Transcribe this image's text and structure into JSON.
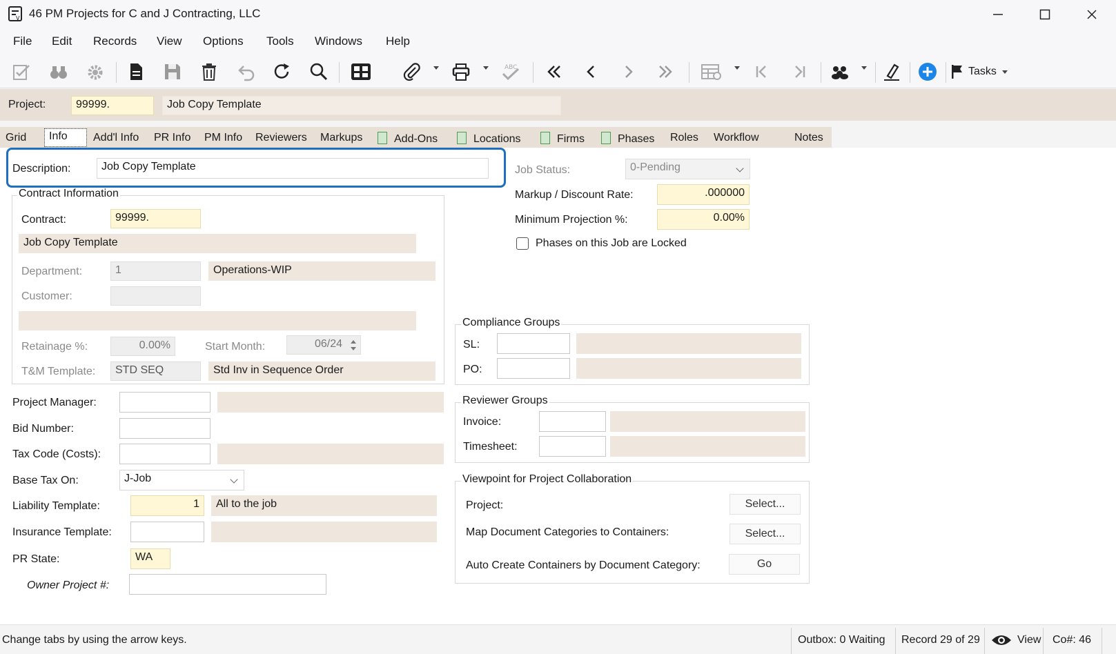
{
  "window": {
    "title": "46 PM Projects for C and J Contracting, LLC",
    "minimize": "—",
    "maximize": "☐",
    "close": "✕"
  },
  "menu": {
    "items": [
      "File",
      "Edit",
      "Records",
      "View",
      "Options",
      "Tools",
      "Windows",
      "Help"
    ]
  },
  "toolbar": {
    "tasks_label": "Tasks",
    "icons": [
      "edit-check-icon",
      "binoculars-icon",
      "settings-gear-icon",
      "new-document-icon",
      "save-icon",
      "delete-icon",
      "undo-icon",
      "refresh-icon",
      "search-icon",
      "grid-view-icon",
      "attachment-icon",
      "print-icon",
      "spellcheck-icon",
      "first-record-icon",
      "previous-record-icon",
      "next-record-icon",
      "last-record-icon",
      "table-layout-icon",
      "first-page-icon",
      "last-page-icon",
      "group-icon",
      "sign-pen-icon",
      "add-circle-icon",
      "flag-icon"
    ]
  },
  "header": {
    "project_label": "Project:",
    "project_value": "99999.",
    "project_name": "Job Copy Template"
  },
  "tabs": {
    "grid": "Grid",
    "info": "Info",
    "addl_info": "Add'l Info",
    "pr_info": "PR Info",
    "pm_info": "PM Info",
    "reviewers": "Reviewers",
    "markups": "Markups",
    "add_ons": "Add-Ons",
    "locations": "Locations",
    "firms": "Firms",
    "phases": "Phases",
    "roles": "Roles",
    "workflow": "Workflow",
    "notes": "Notes"
  },
  "info": {
    "description_label": "Description:",
    "description_value": "Job Copy Template",
    "contract_group_title": "Contract Information",
    "contract_label": "Contract:",
    "contract_value": "99999.",
    "contract_desc": "Job Copy Template",
    "department_label": "Department:",
    "department_value": "1",
    "department_desc": "Operations-WIP",
    "customer_label": "Customer:",
    "customer_value": "",
    "retainage_label": "Retainage %:",
    "retainage_value": "0.00%",
    "start_month_label": "Start Month:",
    "start_month_value": "06/24",
    "tm_template_label": "T&M Template:",
    "tm_template_value": "STD SEQ",
    "tm_template_desc": "Std Inv in Sequence Order",
    "project_manager_label": "Project Manager:",
    "bid_number_label": "Bid Number:",
    "tax_code_label": "Tax Code (Costs):",
    "base_tax_label": "Base Tax On:",
    "base_tax_value": "J-Job",
    "liability_label": "Liability Template:",
    "liability_value": "1",
    "liability_desc": "All to the job",
    "insurance_label": "Insurance Template:",
    "pr_state_label": "PR State:",
    "pr_state_value": "WA",
    "owner_project_label": "Owner Project #:",
    "job_status_label": "Job Status:",
    "job_status_value": "0-Pending",
    "markup_rate_label": "Markup / Discount Rate:",
    "markup_rate_value": ".000000",
    "min_projection_label": "Minimum Projection %:",
    "min_projection_value": "0.00%",
    "phases_locked_label": "Phases on this Job are Locked",
    "compliance_title": "Compliance Groups",
    "sl_label": "SL:",
    "po_label": "PO:",
    "reviewer_groups_title": "Reviewer Groups",
    "invoice_label": "Invoice:",
    "timesheet_label": "Timesheet:",
    "collab_title": "Viewpoint for Project Collaboration",
    "collab_project_label": "Project:",
    "collab_map_label": "Map Document Categories to Containers:",
    "collab_auto_label": "Auto Create Containers by Document Category:",
    "select_label": "Select...",
    "go_label": "Go"
  },
  "status": {
    "hint": "Change tabs by using the arrow keys.",
    "outbox": "Outbox: 0 Waiting",
    "record": "Record 29 of 29",
    "view": "View",
    "company": "Co#: 46"
  },
  "colors": {
    "accent_blue": "#1f6fbf",
    "header_tan": "#e8dfd6",
    "required_yellow": "#fff7d6",
    "readonly_tan": "#efe6dd"
  }
}
